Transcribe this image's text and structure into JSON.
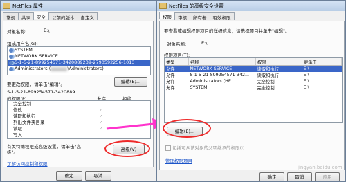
{
  "left_window": {
    "title": "NetFiles 属性",
    "tabs": [
      "常规",
      "共享",
      "安全",
      "以前的版本",
      "自定义"
    ],
    "active_tab": 2,
    "object_label": "对象名称:",
    "object_value": "E:\\",
    "group_label": "组或用户名(G):",
    "users": [
      {
        "name": "SYSTEM",
        "selected": false
      },
      {
        "name": "NETWORK SERVICE",
        "selected": false
      },
      {
        "name": "S-1-5-21-899254571-3420889239-2790592256-1013",
        "selected": true
      },
      {
        "name": "Administrators (",
        "extra": "\\Administrators)",
        "selected": false
      }
    ],
    "edit_hint": "要更改权限，请单击\"编辑\"。",
    "edit_button": "编辑(E)...",
    "perm_for_line1": "S-1-5-21-899254571-3420889",
    "perm_for_line2": "的权限(P)",
    "allow_header": "允许",
    "deny_header": "拒绝",
    "permissions": [
      {
        "name": "完全控制",
        "allow": false
      },
      {
        "name": "修改",
        "allow": true
      },
      {
        "name": "读取和执行",
        "allow": true
      },
      {
        "name": "列出文件夹目录",
        "allow": true
      },
      {
        "name": "读取",
        "allow": true
      },
      {
        "name": "写入",
        "allow": false
      }
    ],
    "special_hint_line1": "有关特殊权限或高级设置，请单击\"高",
    "special_hint_line2": "级\"。",
    "advanced_button": "高级(V)",
    "learn_link": "了解访问控制和权限",
    "ok_button": "确定",
    "cancel_button": "取消"
  },
  "right_window": {
    "title": "NetFiles 的高级安全设置",
    "tabs": [
      "权限",
      "审核",
      "所有者",
      "有效权限"
    ],
    "active_tab": 0,
    "intro": "要查看或编辑权限项目的详细信息，请选择项目并单击\"编辑\"。",
    "object_label": "对象名称:",
    "object_value": "E:\\",
    "entries_label": "权限项目(T):",
    "columns": [
      "类型",
      "名称",
      "权限",
      "继承于"
    ],
    "entries": [
      {
        "type": "允许",
        "name": "NETWORK SERVICE",
        "perm": "读取和执行",
        "from": "E:\\",
        "selected": true
      },
      {
        "type": "允许",
        "name": "S-1-5-21-899254571-342...",
        "perm": "读取和执行",
        "from": "E:\\",
        "selected": false
      },
      {
        "type": "允许",
        "name": "Administrators (HE...",
        "perm": "完全控制",
        "from": "E:\\",
        "selected": false
      },
      {
        "type": "允许",
        "name": "SYSTEM",
        "perm": "完全控制",
        "from": "E:\\",
        "selected": false
      }
    ],
    "edit_button": "编辑(E)...",
    "inherit_checkbox": "包括可从该对象的父项继承的权限(I)",
    "manage_link": "管理权限项目",
    "ok_button": "确定",
    "cancel_button": "取消",
    "apply_button": "应用"
  },
  "watermark": "jingyan.baidu.com",
  "colors": {
    "highlight": "#3a66c8",
    "annotation": "#ee2a2a",
    "arrow": "#ff33cc"
  }
}
